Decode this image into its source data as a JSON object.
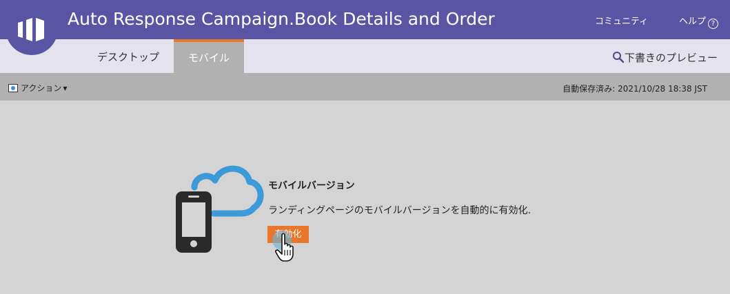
{
  "app": {
    "title": "Auto Response Campaign.Book Details and Order"
  },
  "topnav": {
    "community": "コミュニティ",
    "help": "ヘルプ",
    "help_icon": "?"
  },
  "tabs": [
    {
      "label": "デスクトップ",
      "active": false
    },
    {
      "label": "モバイル",
      "active": true
    }
  ],
  "preview": {
    "label": "下書きのプレビュー",
    "icon": "search-icon"
  },
  "toolbar": {
    "actions_label": "アクション",
    "autosave": "自動保存済み: 2021/10/28 18:38 JST"
  },
  "promo": {
    "heading": "モバイルバージョン",
    "description": "ランディングページのモバイルバージョンを自動的に有効化.",
    "button_label": "有効化"
  },
  "colors": {
    "header": "#5a54a4",
    "accent": "#e8762b",
    "tabbar": "#e4e2ed",
    "toolbar": "#b1b1b1",
    "canvas": "#d4d4d4",
    "cloud": "#3c9ad8",
    "phone": "#2a2a2a"
  }
}
